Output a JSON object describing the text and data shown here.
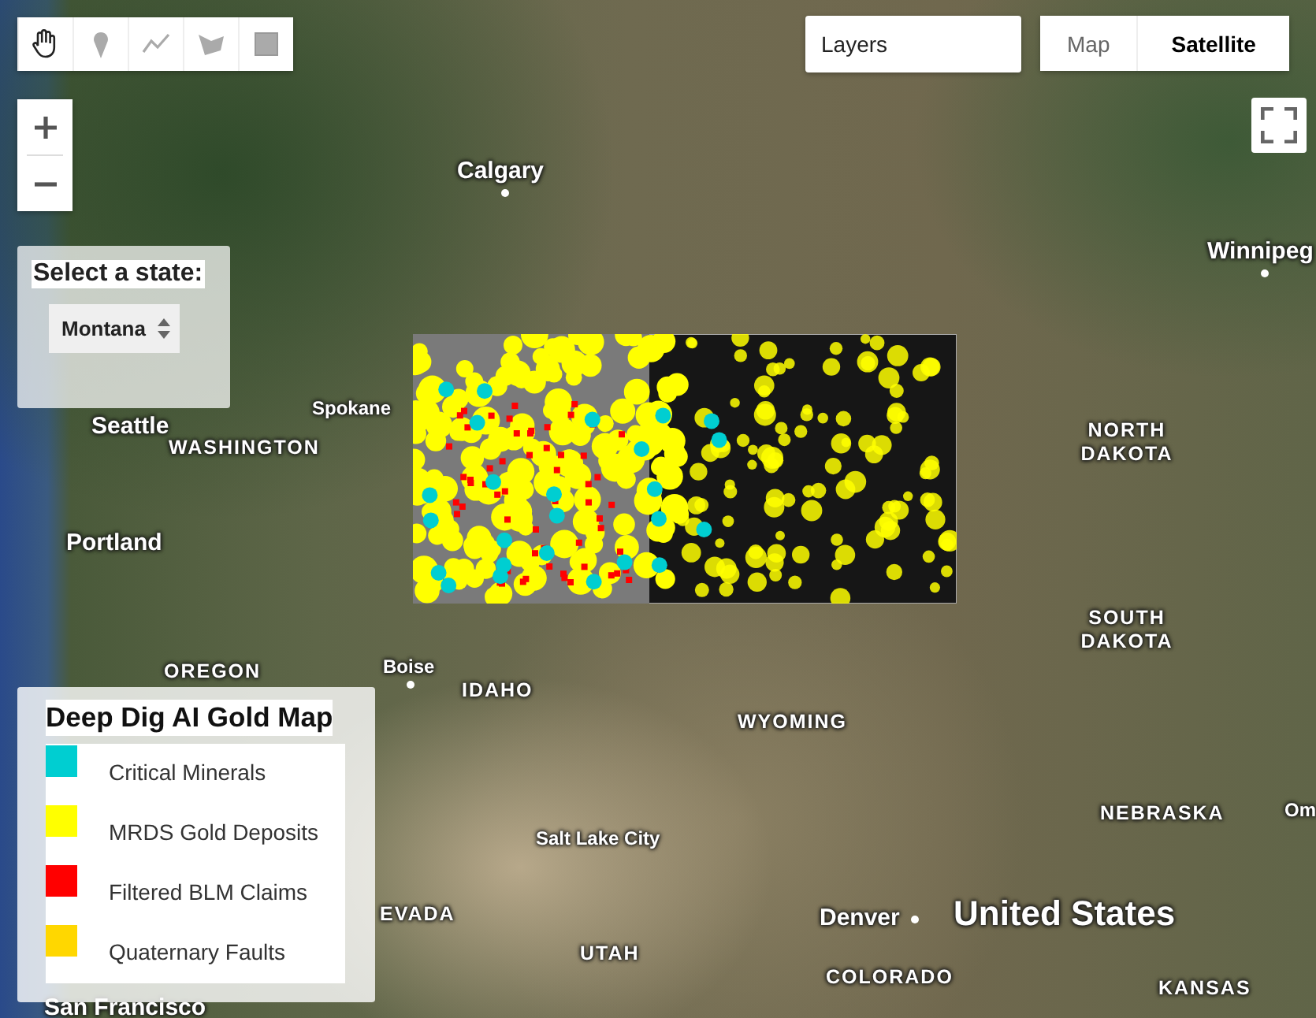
{
  "drawing_tools": [
    {
      "kind": "hand",
      "selected": true
    },
    {
      "kind": "point",
      "selected": false
    },
    {
      "kind": "line",
      "selected": false
    },
    {
      "kind": "polygon",
      "selected": false
    },
    {
      "kind": "rectangle",
      "selected": false
    }
  ],
  "state_selector": {
    "label": "Select a state:",
    "value": "Montana"
  },
  "layers": {
    "label": "Layers"
  },
  "map_type": [
    {
      "label": "Map",
      "selected": false
    },
    {
      "label": "Satellite",
      "selected": true
    }
  ],
  "map_labels": [
    {
      "text": "Calgary",
      "kind": "city"
    },
    {
      "text": "Winnipeg",
      "kind": "city"
    },
    {
      "text": "Seattle",
      "kind": "city"
    },
    {
      "text": "Spokane",
      "kind": "town"
    },
    {
      "text": "WASHINGTON",
      "kind": "state"
    },
    {
      "text": "Portland",
      "kind": "city"
    },
    {
      "text": "OREGON",
      "kind": "state"
    },
    {
      "text": "Boise",
      "kind": "town"
    },
    {
      "text": "IDAHO",
      "kind": "state"
    },
    {
      "text": "NORTH DAKOTA",
      "kind": "state"
    },
    {
      "text": "SOUTH DAKOTA",
      "kind": "state"
    },
    {
      "text": "WYOMING",
      "kind": "state"
    },
    {
      "text": "Salt Lake City",
      "kind": "town"
    },
    {
      "text": "NEBRASKA",
      "kind": "state"
    },
    {
      "text": "Denver",
      "kind": "city"
    },
    {
      "text": "United States",
      "kind": "country"
    },
    {
      "text": "COLORADO",
      "kind": "state"
    },
    {
      "text": "UTAH",
      "kind": "state"
    },
    {
      "text": "KANSAS",
      "kind": "state"
    },
    {
      "text": "EVADA",
      "kind": "state"
    },
    {
      "text": "San Francisco",
      "kind": "city"
    },
    {
      "text": "Om",
      "kind": "town"
    }
  ],
  "legend": {
    "title": "Deep Dig AI Gold Map",
    "items": [
      {
        "label": "Critical Minerals",
        "color": "#00ced1"
      },
      {
        "label": "MRDS Gold Deposits",
        "color": "#ffff00"
      },
      {
        "label": "Filtered BLM Claims",
        "color": "#ff0000"
      },
      {
        "label": "Quaternary Faults",
        "color": "#ffd700"
      }
    ]
  }
}
